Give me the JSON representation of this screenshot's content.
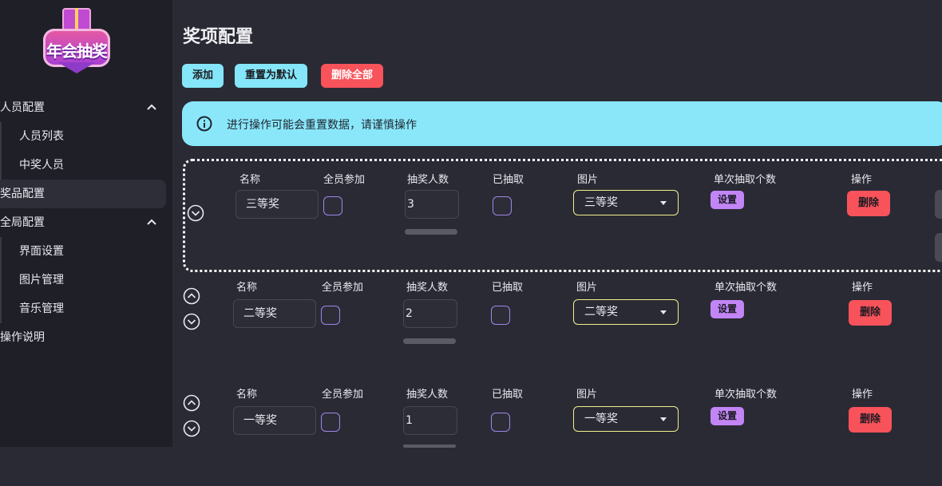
{
  "logo": {
    "text": "年会抽奖"
  },
  "sidebar": {
    "groups": [
      {
        "label": "人员配置",
        "items": [
          {
            "label": "人员列表"
          },
          {
            "label": "中奖人员"
          }
        ]
      },
      {
        "label": "奖品配置"
      },
      {
        "label": "全局配置",
        "items": [
          {
            "label": "界面设置"
          },
          {
            "label": "图片管理"
          },
          {
            "label": "音乐管理"
          }
        ]
      },
      {
        "label": "操作说明"
      }
    ]
  },
  "main": {
    "title": "奖项配置",
    "buttons": {
      "add": "添加",
      "reset": "重置为默认",
      "delete_all": "删除全部"
    },
    "alert": "进行操作可能会重置数据，请谨慎操作",
    "columns": {
      "name": "名称",
      "all_join": "全员参加",
      "count": "抽奖人数",
      "drawn": "已抽取",
      "image": "图片",
      "per_draw": "单次抽取个数",
      "actions": "操作"
    },
    "set_label": "设置",
    "delete_label": "删除",
    "prizes": [
      {
        "name": "三等奖",
        "count": "3",
        "image": "三等奖"
      },
      {
        "name": "二等奖",
        "count": "2",
        "image": "二等奖"
      },
      {
        "name": "一等奖",
        "count": "1",
        "image": "一等奖"
      }
    ]
  },
  "colors": {
    "accent_cyan": "#84e6f8",
    "danger": "#f8525a",
    "purple": "#c285f5",
    "select_border": "#f0f08a"
  }
}
